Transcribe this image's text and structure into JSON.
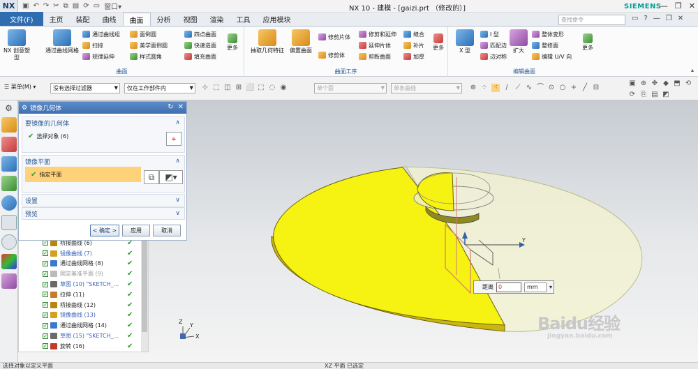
{
  "titlebar": {
    "logo": "NX",
    "window_menu": "窗口",
    "title": "NX 10 - 建模 - [gaizi.prt （修改的）]",
    "brand": "SIEMENS"
  },
  "menubar": {
    "items": [
      "文件(F)",
      "主页",
      "装配",
      "曲线",
      "曲面",
      "分析",
      "视图",
      "渲染",
      "工具",
      "应用模块"
    ],
    "search_placeholder": "查找命令"
  },
  "ribbon": {
    "groups": [
      {
        "label": "曲面"
      },
      {
        "label": "曲面工序"
      },
      {
        "label": "编辑曲面"
      }
    ],
    "buttons": {
      "nx_creative": "NX 创意塑型",
      "through_mesh": "通过曲线网格",
      "through_group": "通过曲线组",
      "sweep": "扫掠",
      "law_ext": "规律延伸",
      "face_blend": "面倒圆",
      "styled_blend": "美学面倒圆",
      "style_round": "样式圆角",
      "four_point": "四点曲面",
      "quick_surface": "快速造面",
      "fill_surface": "填充曲面",
      "more1": "更多",
      "extract": "抽取几何特征",
      "offset": "偏置曲面",
      "trim_sheet": "修剪片体",
      "trim_extend": "修剪和延伸",
      "sew": "缝合",
      "thicken": "加厚",
      "extend_sheet": "延伸片体",
      "patch": "补片",
      "trim_body": "修剪体",
      "split_face": "剪断曲面",
      "more2": "更多",
      "xform": "X 型",
      "i_form": "I 型",
      "match_edge": "匹配边",
      "edge_sym": "边对称",
      "expand": "扩大",
      "global_shape": "整体变形",
      "trim_face": "整修面",
      "edit_uv": "编辑 U/V 向",
      "more3": "更多"
    }
  },
  "toolbar2": {
    "menu_label": "菜单(M)",
    "filter": "没有选择过滤器",
    "scope": "仅在工作部件内",
    "face_rule": "单个面",
    "curve_rule": "单条曲线"
  },
  "dialog": {
    "title": "镜像几何体",
    "section1": "要镜像的几何体",
    "select_objects": "选择对象 (6)",
    "section2": "镜像平面",
    "specify_plane": "指定平面",
    "settings": "设置",
    "preview": "预览",
    "ok": "< 确定 >",
    "apply": "应用",
    "cancel": "取消"
  },
  "navtree": {
    "rows": [
      {
        "label": "桥接曲线 (6)",
        "style": "normal",
        "icon": "bridge-curve-icon"
      },
      {
        "label": "镜像曲线 (7)",
        "style": "blue",
        "icon": "mirror-curve-icon"
      },
      {
        "label": "通过曲线网格 (8)",
        "style": "normal",
        "icon": "mesh-surface-icon"
      },
      {
        "label": "固定基准平面 (9)",
        "style": "gray",
        "icon": "datum-plane-icon"
      },
      {
        "label": "草图 (10) \"SKETCH_...",
        "style": "blue",
        "icon": "sketch-icon"
      },
      {
        "label": "拉伸 (11)",
        "style": "normal",
        "icon": "extrude-icon"
      },
      {
        "label": "桥接曲线 (12)",
        "style": "normal",
        "icon": "bridge-curve-icon"
      },
      {
        "label": "镜像曲线 (13)",
        "style": "blue",
        "icon": "mirror-curve-icon"
      },
      {
        "label": "通过曲线网格 (14)",
        "style": "normal",
        "icon": "mesh-surface-icon"
      },
      {
        "label": "草图 (15) \"SKETCH_...",
        "style": "blue",
        "icon": "sketch-icon"
      },
      {
        "label": "旋转 (16)",
        "style": "normal",
        "icon": "revolve-icon"
      }
    ]
  },
  "viewport": {
    "axis_y": "Y",
    "triad_z": "Z",
    "triad_x": "X",
    "triad_y": "Y",
    "distance_label": "距离",
    "distance_value": "0",
    "unit": "mm"
  },
  "watermark": {
    "brand": "Baidu经验",
    "url": "jingyan.baidu.com"
  },
  "status": {
    "left": "选择对象以定义平面",
    "middle": "XZ 平面 已选定"
  },
  "colors": {
    "accent": "#2f6db0",
    "selection_yellow": "#f6f211",
    "dialog_highlight": "#ffd27a"
  }
}
